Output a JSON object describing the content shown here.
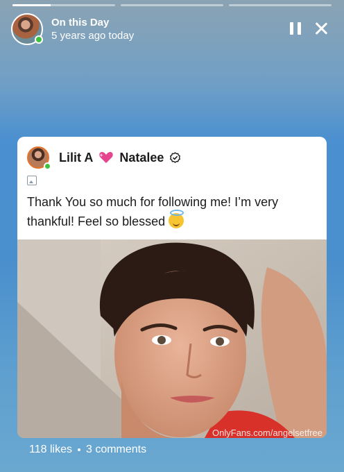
{
  "progress": {
    "segments": [
      {
        "fill": 0.37
      },
      {
        "fill": 0
      },
      {
        "fill": 0
      }
    ]
  },
  "header": {
    "title": "On this Day",
    "subtitle": "5 years ago today",
    "avatar_icon": "profile-avatar",
    "pause_icon": "pause-icon",
    "close_icon": "close-icon"
  },
  "post": {
    "author_first": "Lilit A",
    "author_second": "Natalee",
    "heart_icon": "sparkling-heart-icon",
    "verified_icon": "verified-badge-icon",
    "media_icon": "image-icon",
    "text": "Thank You so much for following me! I’m very thankful! Feel so blessed",
    "emoji_icon": "smiling-face-with-halo-icon",
    "watermark": "OnlyFans.com/angelsetfree"
  },
  "stats": {
    "likes": "118 likes",
    "comments": "3 comments"
  },
  "colors": {
    "online": "#3fc13f",
    "avatar_ring": "#e8722a",
    "accent_background": "#4a8fd0"
  }
}
